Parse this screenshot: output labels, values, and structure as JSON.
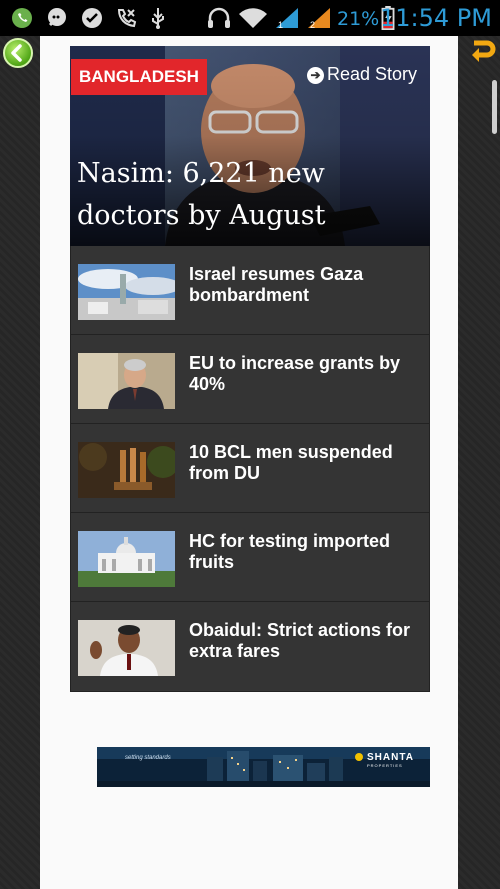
{
  "status_bar": {
    "battery_percent": "21%",
    "time": "11:54 PM",
    "icons": [
      "whatsapp-icon",
      "chat-icon",
      "check-icon",
      "call-icon",
      "usb-icon",
      "headset-icon",
      "wifi-icon",
      "signal-1-icon",
      "signal-2-icon",
      "battery-icon"
    ]
  },
  "nav": {
    "back_icon": "back-arrow-icon",
    "reload_icon": "reload-icon"
  },
  "hero": {
    "tag": "BANGLADESH",
    "read_story": "Read Story",
    "title": "Nasim: 6,221 new doctors by August"
  },
  "news": [
    {
      "title": "Israel resumes Gaza bombardment",
      "thumb": "buildings-sky"
    },
    {
      "title": "EU to increase grants by 40%",
      "thumb": "man-speaking"
    },
    {
      "title": "10 BCL men suspended from DU",
      "thumb": "statue-trees"
    },
    {
      "title": "HC for testing imported fruits",
      "thumb": "court-building"
    },
    {
      "title": "Obaidul: Strict actions for extra fares",
      "thumb": "man-gesturing"
    }
  ],
  "ad": {
    "slogan": "setting standards",
    "brand": "SHANTA",
    "brand_sub": "PROPERTIES"
  },
  "colors": {
    "tag_red": "#e2262b",
    "status_blue": "#2e9bd6",
    "list_bg": "#343434"
  }
}
